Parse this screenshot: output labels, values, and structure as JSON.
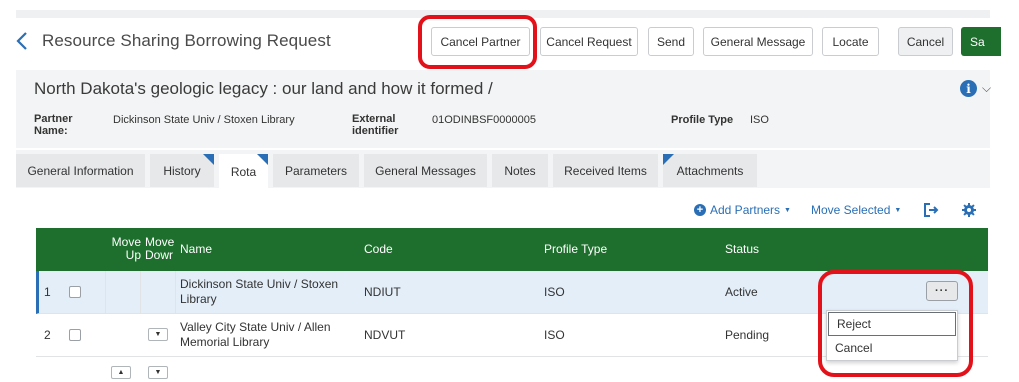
{
  "header": {
    "title": "Resource Sharing Borrowing Request",
    "buttons": {
      "cancel_partner": "Cancel Partner",
      "cancel_request": "Cancel Request",
      "send": "Send",
      "general_message": "General Message",
      "locate": "Locate",
      "cancel": "Cancel",
      "save": "Sa"
    }
  },
  "record": {
    "title": "North Dakota's geologic legacy : our land and how it formed /",
    "partner_name_label": "Partner Name:",
    "partner_name_value": "Dickinson State Univ / Stoxen Library",
    "external_identifier_label": "External identifier",
    "external_identifier_value": "01ODINBSF0000005",
    "profile_type_label": "Profile Type",
    "profile_type_value": "ISO"
  },
  "tabs": [
    {
      "label": "General Information"
    },
    {
      "label": "History"
    },
    {
      "label": "Rota"
    },
    {
      "label": "Parameters"
    },
    {
      "label": "General Messages"
    },
    {
      "label": "Notes"
    },
    {
      "label": "Received Items"
    },
    {
      "label": "Attachments"
    }
  ],
  "toolbar": {
    "add_partners": "Add Partners",
    "move_selected": "Move Selected"
  },
  "table": {
    "headers": {
      "move_up": "Move Up",
      "move_down": "Move Dowr",
      "name": "Name",
      "code": "Code",
      "profile_type": "Profile Type",
      "status": "Status"
    },
    "rows": [
      {
        "num": "1",
        "name": "Dickinson State Univ / Stoxen Library",
        "code": "NDIUT",
        "profile_type": "ISO",
        "status": "Active"
      },
      {
        "num": "2",
        "name": "Valley City State Univ / Allen Memorial Library",
        "code": "NDVUT",
        "profile_type": "ISO",
        "status": "Pending"
      }
    ],
    "more_button": "···"
  },
  "row_menu": {
    "items": [
      "Reject",
      "Cancel"
    ]
  },
  "colors": {
    "accent_blue": "#2a6fb5",
    "header_green": "#1e6f2d",
    "highlight_red": "#e3121a",
    "selected_row": "#e3eef9"
  },
  "icons": [
    "back-chevron-icon",
    "info-icon",
    "plus-circle-icon",
    "caret-down-icon",
    "export-icon",
    "gear-icon",
    "more-icon"
  ]
}
